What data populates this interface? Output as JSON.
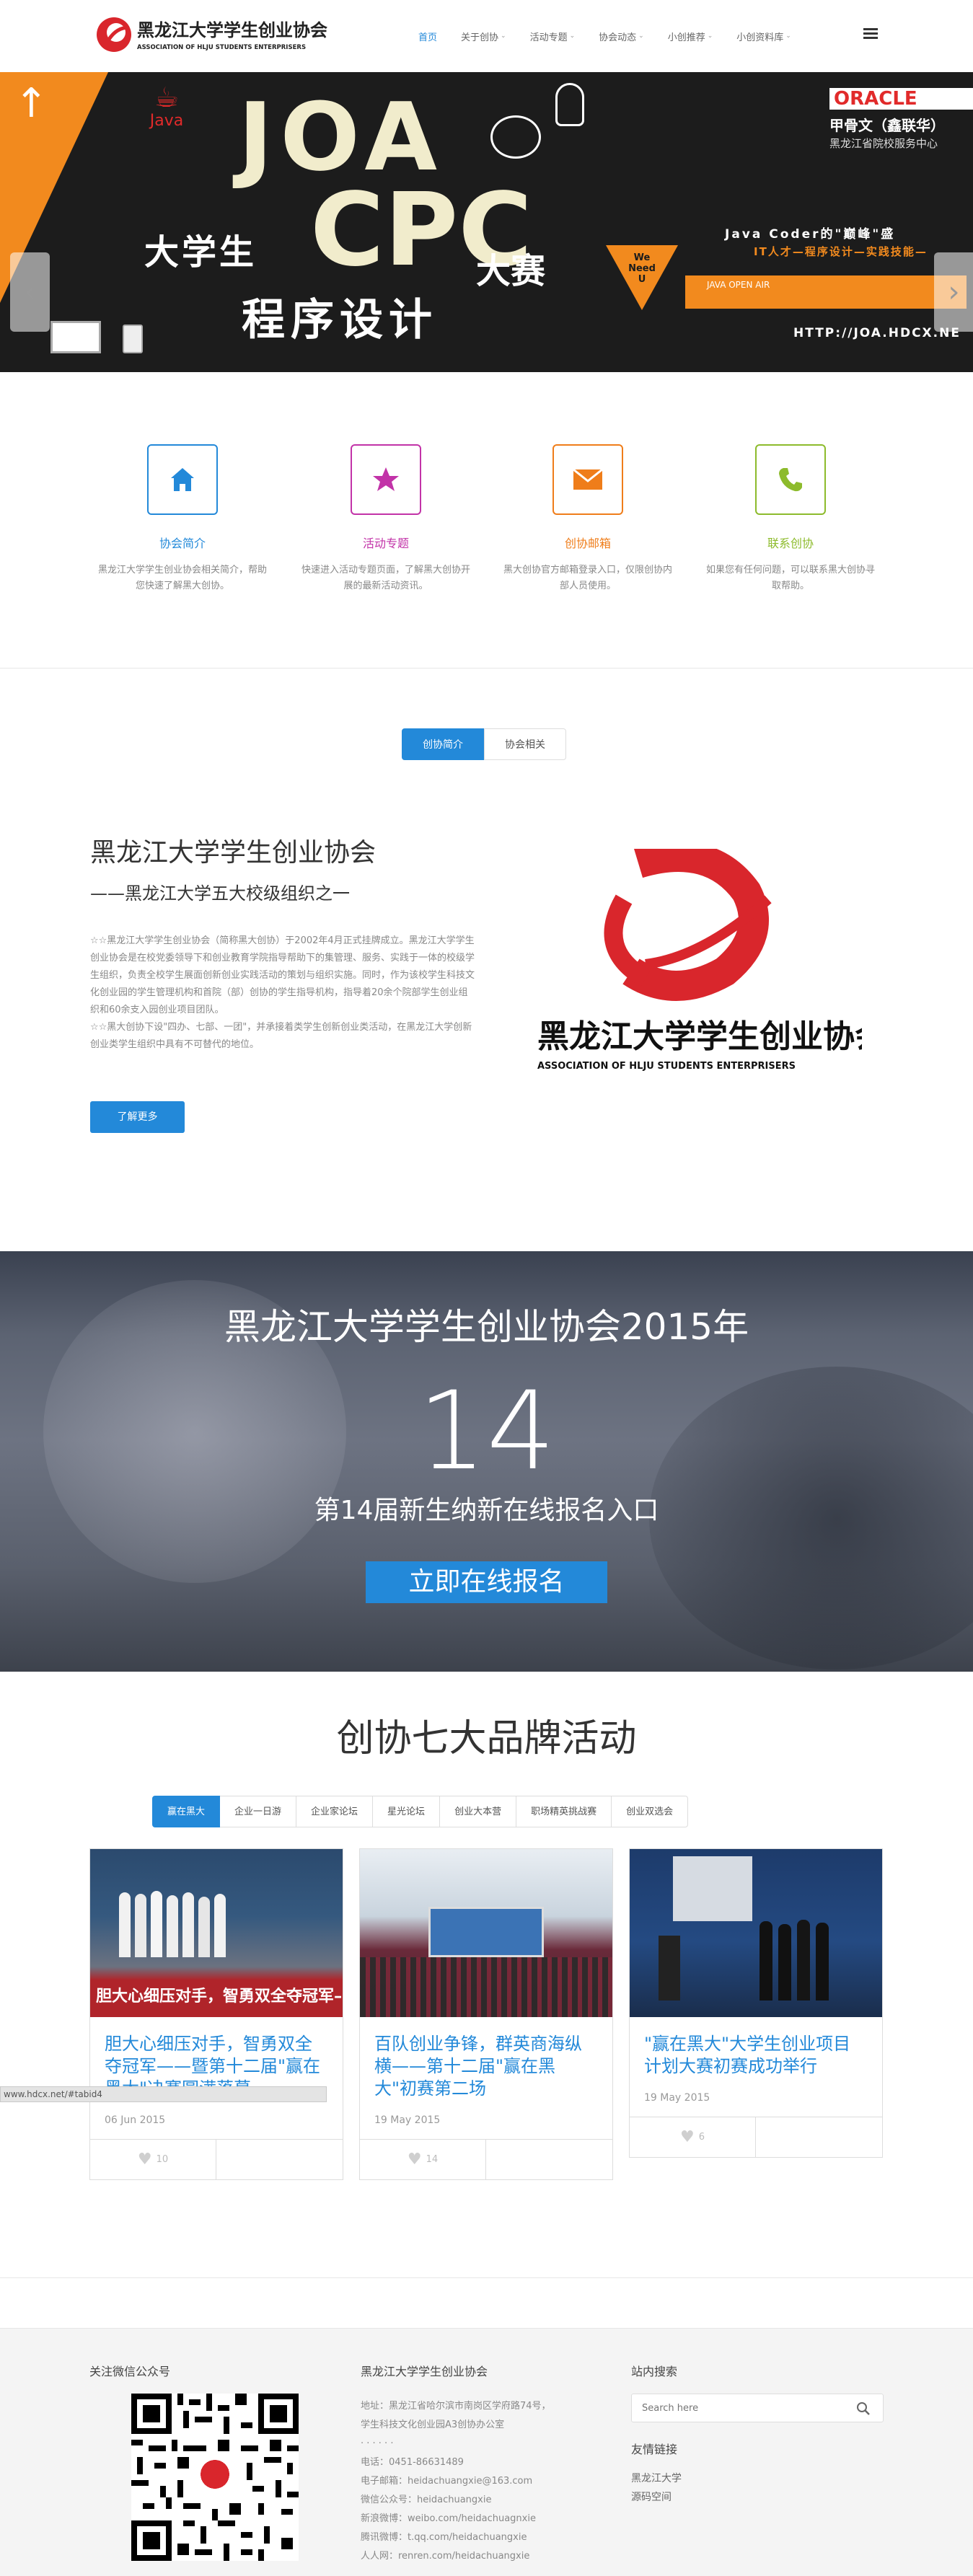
{
  "header": {
    "logo_title": "黑龙江大学学生创业协会",
    "logo_subtitle": "ASSOCIATION OF HLJU STUDENTS ENTERPRISERS",
    "nav": [
      {
        "label": "首页",
        "active": true,
        "has_dropdown": false
      },
      {
        "label": "关于创协",
        "active": false,
        "has_dropdown": true
      },
      {
        "label": "活动专题",
        "active": false,
        "has_dropdown": true
      },
      {
        "label": "协会动态",
        "active": false,
        "has_dropdown": true
      },
      {
        "label": "小创推荐",
        "active": false,
        "has_dropdown": true
      },
      {
        "label": "小创资料库",
        "active": false,
        "has_dropdown": true
      }
    ],
    "chevron": "⌄"
  },
  "banner": {
    "java": "Java",
    "joa": "JOA",
    "cpc": "CPC",
    "line1": "大学生",
    "line1b": "大赛",
    "line2": "程序设计",
    "oracle": "ORACLE",
    "oracle_sub1": "甲骨文（鑫联华）",
    "oracle_sub2": "黑龙江省院校服务中心",
    "tag1": "Java Coder的\"巅峰\"盛",
    "tag2": "IT人才—程序设计—实践技能—",
    "we_need": "We Need U",
    "java_air": "JAVA OPEN AIR",
    "url": "HTTP://JOA.HDCX.NE"
  },
  "features": [
    {
      "title": "协会简介",
      "desc": "黑龙江大学学生创业协会相关简介，帮助您快速了解黑大创协。",
      "color": "#2389d9",
      "icon": "home-icon"
    },
    {
      "title": "活动专题",
      "desc": "快速进入活动专题页面，了解黑大创协开展的最新活动资讯。",
      "color": "#c233a8",
      "icon": "star-icon"
    },
    {
      "title": "创协邮箱",
      "desc": "黑大创协官方邮箱登录入口，仅限创协内部人员使用。",
      "color": "#ef7d1a",
      "icon": "mail-icon"
    },
    {
      "title": "联系创协",
      "desc": "如果您有任何问题，可以联系黑大创协寻取帮助。",
      "color": "#8dbb2c",
      "icon": "phone-icon"
    }
  ],
  "about": {
    "tabs": [
      "创协简介",
      "协会相关"
    ],
    "title": "黑龙江大学学生创业协会",
    "subtitle": "——黑龙江大学五大校级组织之一",
    "body1": "☆☆黑龙江大学学生创业协会（简称黑大创协）于2002年4月正式挂牌成立。黑龙江大学学生创业协会是在校党委领导下和创业教育学院指导帮助下的集管理、服务、实践于一体的校级学生组织，负责全校学生展面创新创业实践活动的策划与组织实施。同时，作为该校学生科技文化创业园的学生管理机构和首院（部）创协的学生指导机构，指导着20余个院部学生创业组织和60余支入园创业项目团队。",
    "body2": "☆☆黑大创协下设\"四办、七部、一团\"，并承接着类学生创新创业类活动，在黑龙江大学创新创业类学生组织中具有不可替代的地位。",
    "button": "了解更多",
    "logo_cn": "黑龙江大学学生创业协会",
    "logo_en": "ASSOCIATION OF HLJU STUDENTS ENTERPRISERS"
  },
  "enroll": {
    "title": "黑龙江大学学生创业协会2015年",
    "number": "14",
    "subtitle": "第14届新生纳新在线报名入口",
    "button": "立即在线报名"
  },
  "brand": {
    "title": "创协七大品牌活动",
    "tabs": [
      "赢在黑大",
      "企业一日游",
      "企业家论坛",
      "星光论坛",
      "创业大本营",
      "职场精英挑战赛",
      "创业双选会"
    ],
    "cards": [
      {
        "title": "胆大心细压对手，智勇双全夺冠军——暨第十二届\"赢在黑大\"决赛圆满落幕",
        "date": "06 Jun 2015",
        "likes": "10"
      },
      {
        "title": "百队创业争锋，群英商海纵横——第十二届\"赢在黑大\"初赛第二场",
        "date": "19 May 2015",
        "likes": "14"
      },
      {
        "title": "\"赢在黑大\"大学生创业项目计划大赛初赛成功举行",
        "date": "19 May 2015",
        "likes": "6"
      }
    ],
    "photo_banner": "胆大心细压对手，智勇双全夺冠军——暨第十二",
    "status_url": "www.hdcx.net/#tabid4"
  },
  "footer": {
    "wechat_title": "关注微信公众号",
    "org_title": "黑龙江大学学生创业协会",
    "search_title": "站内搜索",
    "search_placeholder": "Search here",
    "links_title": "友情链接",
    "links": [
      "黑龙江大学",
      "源码空间"
    ],
    "contact": [
      "地址：黑龙江省哈尔滨市南岗区学府路74号，",
      "学生科技文化创业园A3创协办公室",
      "· · · · · ·",
      "电话：0451-86631489",
      "电子邮箱：heidachuangxie@163.com",
      "微信公众号：heidachuangxie",
      "新浪微博：weibo.com/heidachuagnxie",
      "腾讯微博：t.qq.com/heidachuangxie",
      "人人网：renren.com/heidachuangxie"
    ]
  }
}
